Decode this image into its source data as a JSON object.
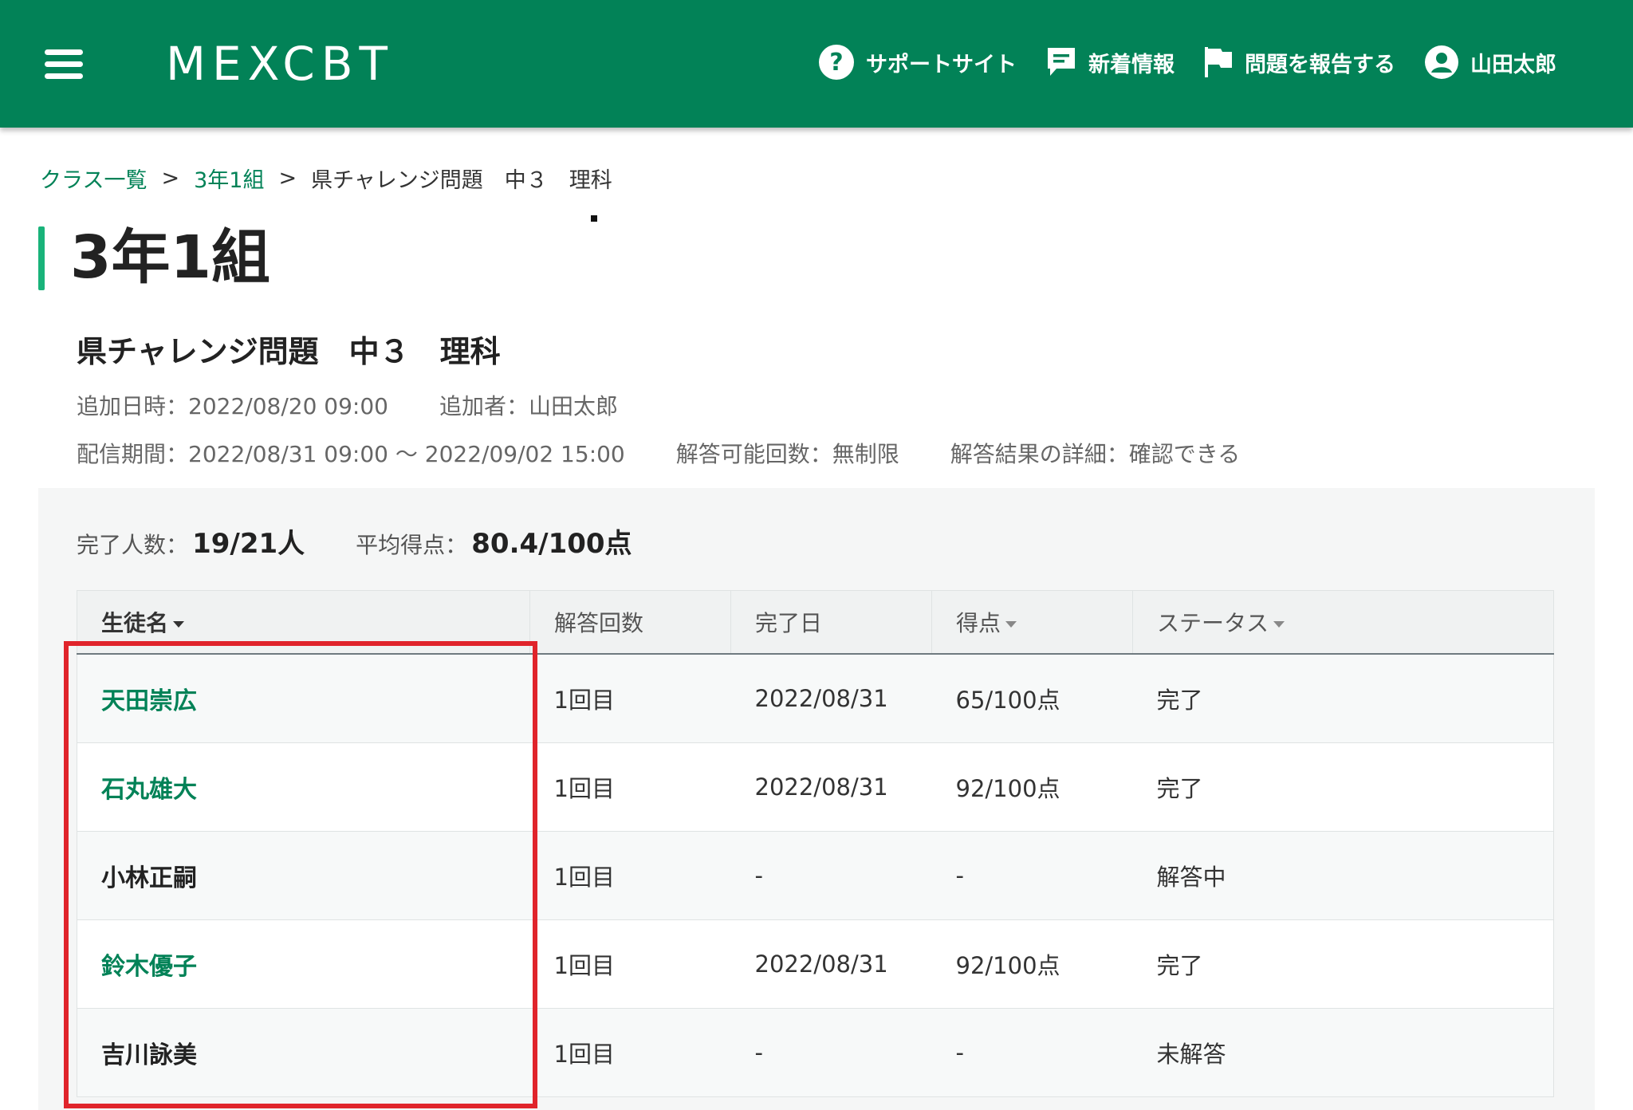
{
  "header": {
    "logo": "MEXCBT",
    "nav": [
      {
        "icon": "help-circle-icon",
        "label": "サポートサイト"
      },
      {
        "icon": "message-icon",
        "label": "新着情報"
      },
      {
        "icon": "flag-icon",
        "label": "問題を報告する"
      },
      {
        "icon": "account-icon",
        "label": "山田太郎"
      }
    ],
    "colors": {
      "brand": "#028257",
      "accent": "#19b37a",
      "highlight": "#e0242b"
    }
  },
  "breadcrumb": {
    "items": [
      "クラス一覧",
      "3年1組"
    ],
    "separator": ">",
    "current": "県チャレンジ問題　中３　理科"
  },
  "page": {
    "title": "3年1組"
  },
  "test": {
    "title": "県チャレンジ問題　中３　理科",
    "added_at": "追加日時：2022/08/20 09:00",
    "added_by": "追加者：山田太郎",
    "period": "配信期間：2022/08/31 09:00 〜 2022/09/02 15:00",
    "attempts_allowed": "解答可能回数：無制限",
    "result_detail": "解答結果の詳細：確認できる"
  },
  "summary": {
    "completed_label": "完了人数：",
    "completed_value": "19/21人",
    "average_label": "平均得点：",
    "average_value": "80.4/100点"
  },
  "table": {
    "columns": [
      {
        "label": "生徒名",
        "sortable": true
      },
      {
        "label": "解答回数",
        "sortable": false
      },
      {
        "label": "完了日",
        "sortable": false
      },
      {
        "label": "得点",
        "sortable": true
      },
      {
        "label": "ステータス",
        "sortable": true
      }
    ],
    "rows": [
      {
        "name": "天田崇広",
        "link": true,
        "attempts": "1回目",
        "date": "2022/08/31",
        "score": "65/100点",
        "status": "完了"
      },
      {
        "name": "石丸雄大",
        "link": true,
        "attempts": "1回目",
        "date": "2022/08/31",
        "score": "92/100点",
        "status": "完了"
      },
      {
        "name": "小林正嗣",
        "link": false,
        "attempts": "1回目",
        "date": "-",
        "score": "-",
        "status": "解答中"
      },
      {
        "name": "鈴木優子",
        "link": true,
        "attempts": "1回目",
        "date": "2022/08/31",
        "score": "92/100点",
        "status": "完了"
      },
      {
        "name": "吉川詠美",
        "link": false,
        "attempts": "1回目",
        "date": "-",
        "score": "-",
        "status": "未解答"
      }
    ]
  }
}
